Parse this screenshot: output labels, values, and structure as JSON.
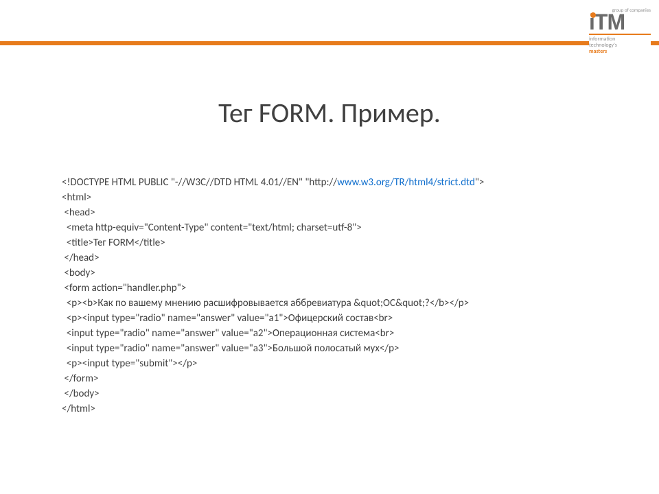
{
  "logo": {
    "top": "group of companies",
    "main": "iTM",
    "sub1": "information",
    "sub2": "technology's",
    "sub3": "masters"
  },
  "title": "Тег FORM. Пример.",
  "code": {
    "l01a": "<!DOCTYPE HTML PUBLIC \"-//W3C//DTD HTML 4.01//EN\" \"http://",
    "l01b": "www.w3.org/TR/html4/strict.dtd",
    "l01c": "\">",
    "l02": "<html>",
    "l03": " <head>",
    "l04": "  <meta http-equiv=\"Content-Type\" content=\"text/html; charset=utf-8\">",
    "l05": "  <title>Тег FORM</title>",
    "l06": " </head>",
    "l07": " <body>",
    "l08": " <form action=\"handler.php\">",
    "l09": "  <p><b>Как по вашему мнению расшифровывается аббревиатура &quot;ОС&quot;?</b></p>",
    "l10": "  <p><input type=\"radio\" name=\"answer\" value=\"a1\">Офицерский состав<br>",
    "l11": "  <input type=\"radio\" name=\"answer\" value=\"a2\">Операционная система<br>",
    "l12": "  <input type=\"radio\" name=\"answer\" value=\"a3\">Большой полосатый мух</p>",
    "l13": "  <p><input type=\"submit\"></p>",
    "l14": " </form>",
    "l15": " </body>",
    "l16": "</html>"
  }
}
